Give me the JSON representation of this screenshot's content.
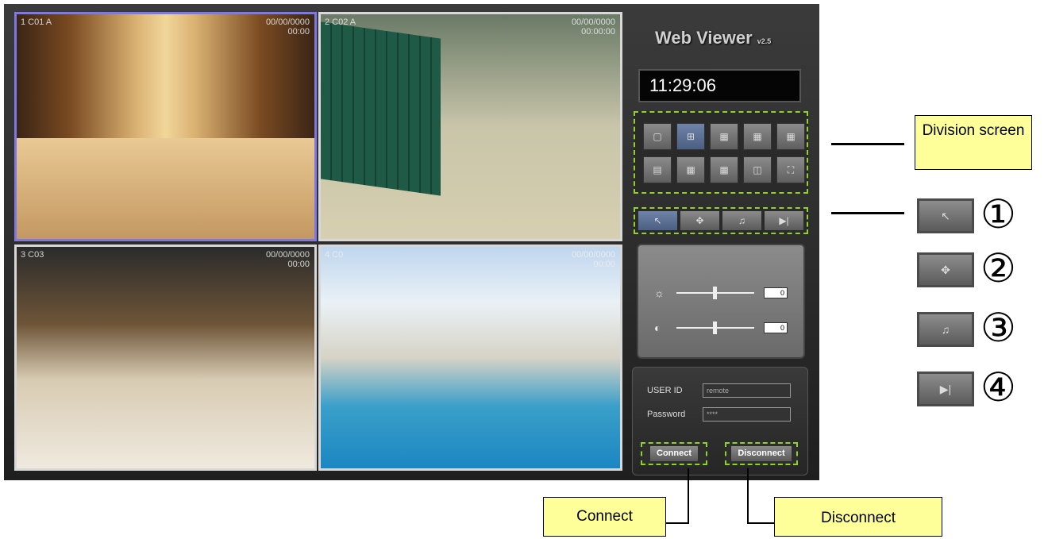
{
  "cameras": [
    {
      "label": "1 C01  A",
      "date": "00/00/0000",
      "time": "00:00"
    },
    {
      "label": "2 C02  A",
      "date": "00/00/0000",
      "time": "00:00:00"
    },
    {
      "label": "3 C03",
      "date": "00/00/0000",
      "time": "00:00"
    },
    {
      "label": "4 C0",
      "date": "00/00/0000",
      "time": "00:00"
    }
  ],
  "panel": {
    "title": "Web Viewer",
    "version": "v2.5",
    "clock": "11:29:06",
    "division_buttons": [
      "1",
      "4",
      "6",
      "8",
      "9",
      "10",
      "13",
      "16",
      "PIP",
      "full"
    ],
    "control_buttons": [
      "mouse-icon",
      "move-icon",
      "bell-icon",
      "next-icon"
    ],
    "brightness_value": "0",
    "contrast_value": "0",
    "user_id_label": "USER ID",
    "user_id_value": "remote",
    "password_label": "Password",
    "password_value": "****",
    "connect_label": "Connect",
    "disconnect_label": "Disconnect"
  },
  "callouts": {
    "division": "Division screen",
    "connect": "Connect",
    "disconnect": "Disconnect"
  },
  "legend": [
    {
      "icon": "mouse-icon",
      "number": "①"
    },
    {
      "icon": "move-icon",
      "number": "②"
    },
    {
      "icon": "bell-icon",
      "number": "③"
    },
    {
      "icon": "next-icon",
      "number": "④"
    }
  ],
  "colors": {
    "highlight": "#8fd22a",
    "callout": "#ffff99",
    "selected_camera": "#7d78e6"
  }
}
